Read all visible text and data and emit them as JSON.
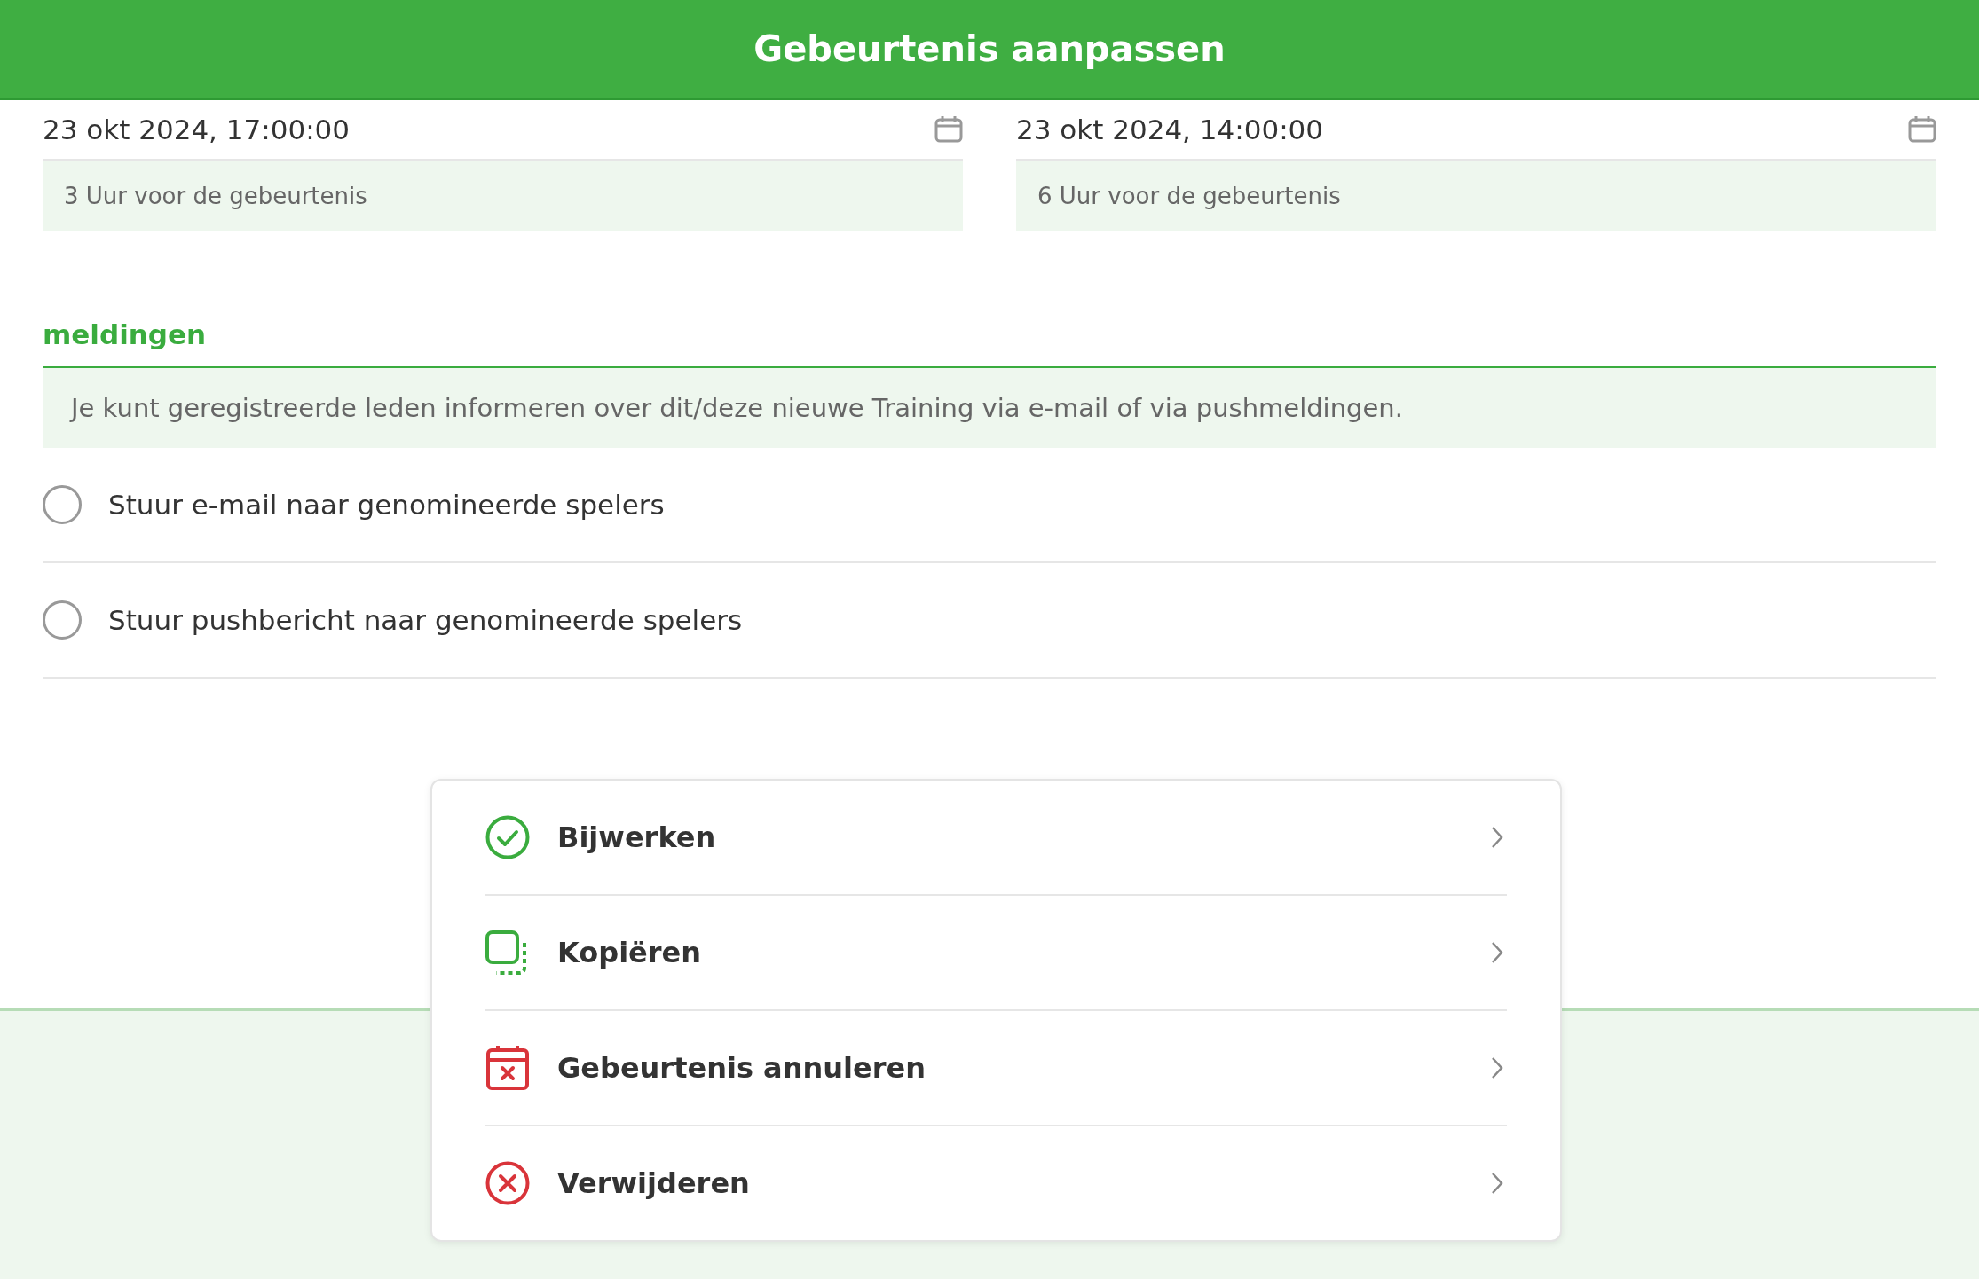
{
  "header": {
    "title": "Gebeurtenis aanpassen"
  },
  "dates": [
    {
      "value": "23 okt 2024, 17:00:00",
      "hint": "3 Uur voor de gebeurtenis"
    },
    {
      "value": "23 okt 2024, 14:00:00",
      "hint": "6 Uur voor de gebeurtenis"
    }
  ],
  "notifications": {
    "heading": "meldingen",
    "info": "Je kunt geregistreerde leden informeren over dit/deze nieuwe Training via e-mail of via pushmeldingen.",
    "options": [
      {
        "label": "Stuur e-mail naar genomineerde spelers",
        "checked": false
      },
      {
        "label": "Stuur pushbericht naar genomineerde spelers",
        "checked": false
      }
    ]
  },
  "actions": [
    {
      "kind": "update",
      "label": "Bijwerken"
    },
    {
      "kind": "copy",
      "label": "Kopiëren"
    },
    {
      "kind": "cancel",
      "label": "Gebeurtenis annuleren"
    },
    {
      "kind": "delete",
      "label": "Verwijderen"
    }
  ]
}
